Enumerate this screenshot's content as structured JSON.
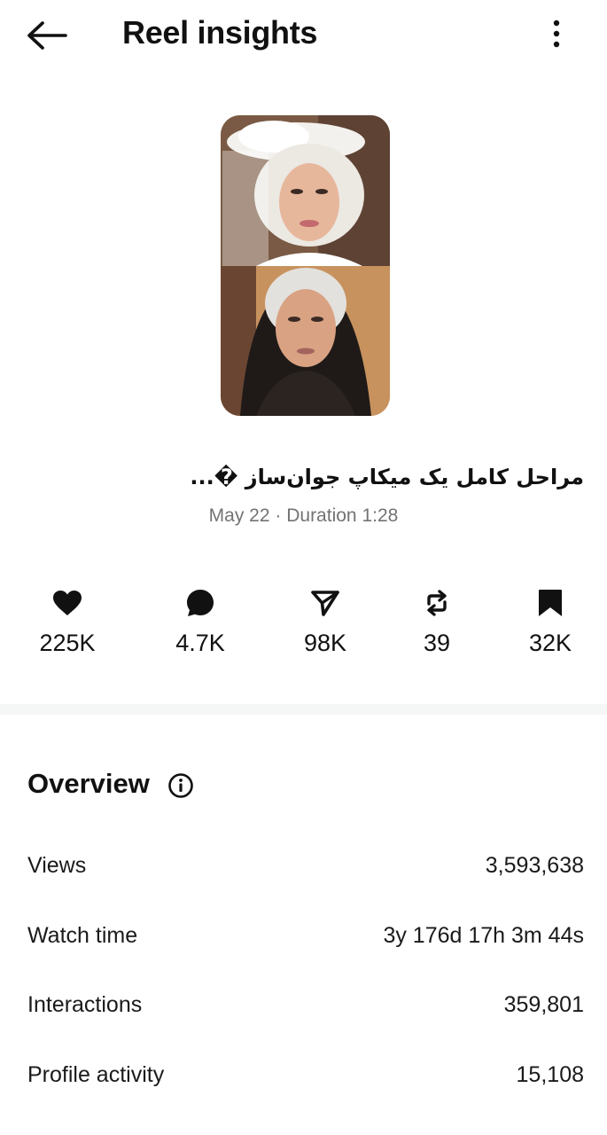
{
  "header": {
    "title": "Reel insights",
    "back_icon": "arrow-left-icon",
    "more_icon": "more-vertical-icon"
  },
  "reel": {
    "thumbnail": "before-after-makeup-thumbnail",
    "caption": "مراحل کامل یک میکاپ جوان‌ساز �...",
    "date": "May 22",
    "separator": "·",
    "duration_label": "Duration",
    "duration": "1:28"
  },
  "stats": [
    {
      "icon": "heart-icon",
      "value": "225K"
    },
    {
      "icon": "comment-icon",
      "value": "4.7K"
    },
    {
      "icon": "send-icon",
      "value": "98K"
    },
    {
      "icon": "repost-icon",
      "value": "39"
    },
    {
      "icon": "bookmark-icon",
      "value": "32K"
    }
  ],
  "overview": {
    "title": "Overview",
    "info_icon": "info-icon",
    "rows": [
      {
        "label": "Views",
        "value": "3,593,638"
      },
      {
        "label": "Watch time",
        "value": "3y 176d 17h 3m 44s"
      },
      {
        "label": "Interactions",
        "value": "359,801"
      },
      {
        "label": "Profile activity",
        "value": "15,108"
      }
    ]
  },
  "colors": {
    "text": "#111111",
    "muted": "#737373",
    "divider": "#f5f7f7"
  }
}
